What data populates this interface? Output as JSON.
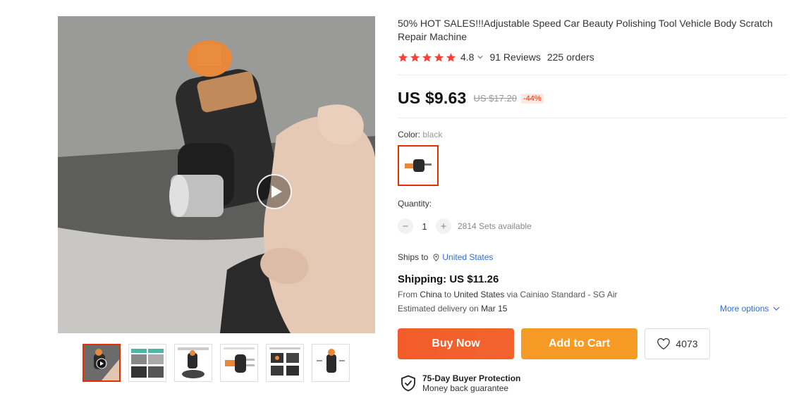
{
  "product": {
    "title": "50% HOT SALES!!!Adjustable Speed Car Beauty Polishing Tool Vehicle Body Scratch Repair Machine",
    "rating": "4.8",
    "stars_filled": 5,
    "reviews": "91 Reviews",
    "orders": "225 orders"
  },
  "price": {
    "current": "US $9.63",
    "original": "US $17.20",
    "discount": "-44%"
  },
  "color": {
    "label": "Color: ",
    "selected": "black"
  },
  "quantity": {
    "label": "Quantity:",
    "minus": "−",
    "value": "1",
    "plus": "+",
    "available": "2814 Sets available"
  },
  "shipping": {
    "ships_to_label": "Ships to",
    "destination": "United States",
    "cost": "Shipping: US $11.26",
    "from_prefix": "From ",
    "from_country": "China",
    "to_word": " to ",
    "to_country": "United States",
    "via": " via Cainiao Standard - SG Air",
    "eta_prefix": "Estimated delivery on ",
    "eta_date": "Mar 15",
    "more_options": "More options"
  },
  "actions": {
    "buy_now": "Buy Now",
    "add_to_cart": "Add to Cart",
    "wishlist_count": "4073"
  },
  "protection": {
    "title": "75-Day Buyer Protection",
    "subtitle": "Money back guarantee"
  },
  "colors": {
    "accent": "#e62e04",
    "buy": "#f25c2a",
    "cart": "#f59a24",
    "link": "#2e6fd9",
    "star": "#f44336"
  },
  "icons": [
    "play-icon",
    "star-icon",
    "chevron-down-icon",
    "location-pin-icon",
    "heart-icon",
    "shield-check-icon"
  ]
}
